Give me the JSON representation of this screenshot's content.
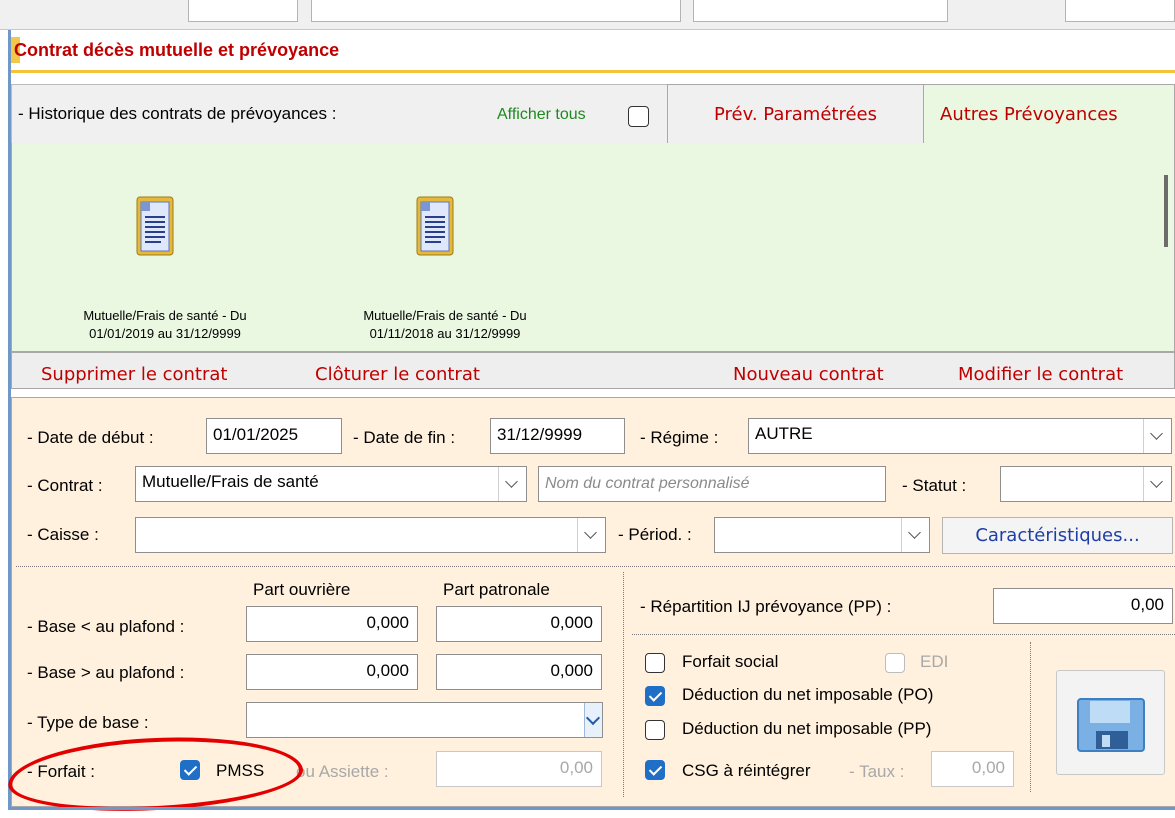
{
  "section": {
    "title": "Contrat décès mutuelle et prévoyance"
  },
  "history": {
    "label": "- Historique des contrats de prévoyances :",
    "show_all_label": "Afficher tous",
    "show_all_checked": false,
    "tabs": [
      {
        "label": "Prév. Paramétrées",
        "active": false
      },
      {
        "label": "Autres Prévoyances",
        "active": true
      }
    ],
    "items": [
      {
        "line1": "Mutuelle/Frais de santé - Du",
        "line2": "01/01/2019 au 31/12/9999"
      },
      {
        "line1": "Mutuelle/Frais de santé - Du",
        "line2": "01/11/2018 au 31/12/9999"
      }
    ],
    "item_icon": "document-icon"
  },
  "actions": {
    "delete": "Supprimer le contrat",
    "close": "Clôturer le contrat",
    "new": "Nouveau contrat",
    "modify": "Modifier le contrat"
  },
  "form": {
    "start_label": "- Date de début :",
    "start_value": "01/01/2025",
    "end_label": "- Date de fin :",
    "end_value": "31/12/9999",
    "regime_label": "- Régime :",
    "regime_value": "AUTRE",
    "contrat_label": "- Contrat :",
    "contrat_value": "Mutuelle/Frais de santé",
    "custom_name_placeholder": "Nom du contrat personnalisé",
    "statut_label": "- Statut :",
    "statut_value": "",
    "caisse_label": "- Caisse :",
    "caisse_value": "",
    "periode_label": "- Périod. :",
    "periode_value": "",
    "caract_button": "Caractéristiques...",
    "part_ouvriere_header": "Part ouvrière",
    "part_patronale_header": "Part patronale",
    "base_below_label": "- Base < au plafond :",
    "base_below_po": "0,000",
    "base_below_pp": "0,000",
    "base_above_label": "- Base > au plafond :",
    "base_above_po": "0,000",
    "base_above_pp": "0,000",
    "type_base_label": "- Type de base :",
    "type_base_value": "",
    "forfait_label": "- Forfait :",
    "pmss_label": "PMSS",
    "pmss_checked": true,
    "assiette_label": "ou Assiette :",
    "assiette_value": "0,00",
    "repartition_label": "- Répartition IJ prévoyance (PP) :",
    "repartition_value": "0,00",
    "forfait_social_label": "Forfait social",
    "forfait_social_checked": false,
    "edi_label": "EDI",
    "edi_checked": false,
    "deduction_po_label": "Déduction du net imposable (PO)",
    "deduction_po_checked": true,
    "deduction_pp_label": "Déduction du net imposable (PP)",
    "deduction_pp_checked": false,
    "csg_label": "CSG à réintégrer",
    "csg_checked": true,
    "taux_label": "- Taux :",
    "taux_value": "0,00",
    "save_icon": "floppy-disk-icon"
  },
  "colors": {
    "title_red": "#c00000",
    "green_panel": "#eaf8e2",
    "form_bg": "#fff1dd",
    "check_blue": "#1f6fc7",
    "annotation_red": "#e30000",
    "link_blue": "#1e3ea6"
  }
}
